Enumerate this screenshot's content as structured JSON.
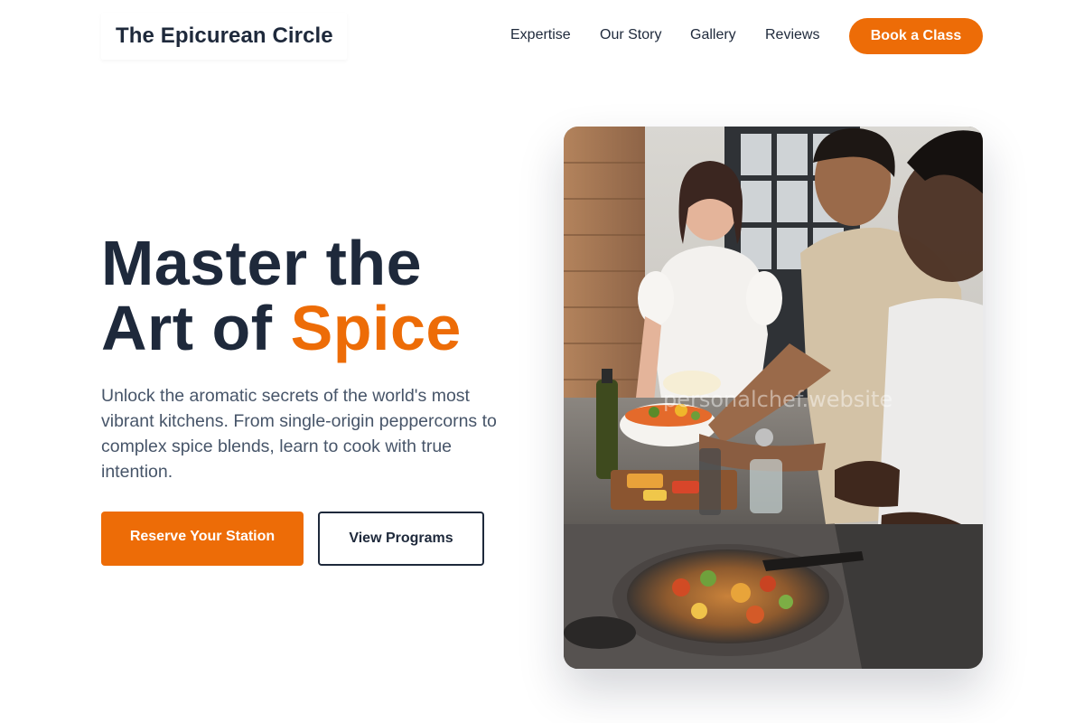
{
  "header": {
    "logo": "The Epicurean Circle",
    "nav": [
      "Expertise",
      "Our Story",
      "Gallery",
      "Reviews"
    ],
    "cta": "Book a Class"
  },
  "hero": {
    "headline_line1": "Master the",
    "headline_line2_prefix": "Art of ",
    "headline_accent": "Spice",
    "subtext": "Unlock the aromatic secrets of the world's most vibrant kitchens. From single-origin peppercorns to complex spice blends, learn to cook with true intention.",
    "primary_button": "Reserve Your Station",
    "secondary_button": "View Programs",
    "image_watermark": "personalchef.website"
  },
  "colors": {
    "accent": "#ed6c07",
    "text_dark": "#1e293b",
    "text_muted": "#475569"
  }
}
